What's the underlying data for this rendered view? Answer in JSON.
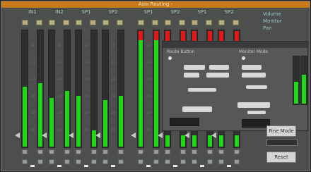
{
  "window": {
    "title": "Asio Routing - "
  },
  "legend": {
    "line1": "Volume",
    "line2": "Monitor",
    "line3": "Pan"
  },
  "panel": {
    "title": "",
    "left_label": "Route Button",
    "right_label": "Monitor Mode"
  },
  "right_panel": {
    "button_top": "Fine Mode",
    "button_bottom": "Reset"
  },
  "colors": {
    "meter_green": "#23d51a",
    "meter_clip": "#e21717",
    "meter_warn": "#c9e12b",
    "titlebar": "#c9781a"
  },
  "strips": [
    {
      "name": "IN1",
      "level_l": 0.52,
      "level_r": 0.55,
      "clip": false,
      "warn": false
    },
    {
      "name": "IN2",
      "level_l": 0.42,
      "level_r": 0.48,
      "clip": false,
      "warn": false
    },
    {
      "name": "SP1",
      "level_l": 0.44,
      "level_r": 0.14,
      "clip": false,
      "warn": false
    },
    {
      "name": "SP2",
      "level_l": 0.4,
      "level_r": 0.44,
      "clip": false,
      "warn": false
    },
    {
      "name": "SP1",
      "level_l": 0.92,
      "level_r": 0.92,
      "clip": true,
      "warn": true
    },
    {
      "name": "SP2",
      "level_l": 0.1,
      "level_r": 0.1,
      "clip": true,
      "warn": false
    },
    {
      "name": "SP1",
      "level_l": 0.1,
      "level_r": 0.1,
      "clip": true,
      "warn": false
    },
    {
      "name": "SP2",
      "level_l": 0.1,
      "level_r": 0.1,
      "clip": true,
      "warn": false
    }
  ],
  "ticks": [
    "-6",
    "-12",
    "-24",
    "-36",
    "-48",
    "-60"
  ]
}
